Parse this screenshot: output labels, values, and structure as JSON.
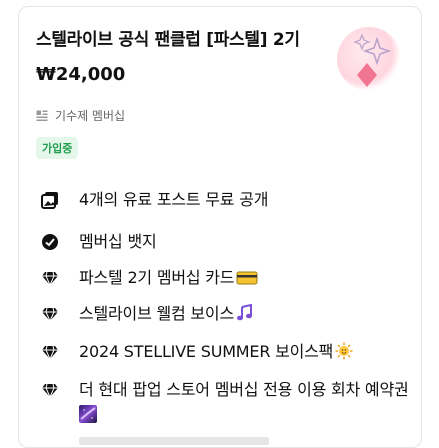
{
  "product": {
    "title": "스텔라이브 공식 팬클럽 [파스텔] 2기",
    "price": "₩24,000",
    "category": "기수제 멤버십",
    "status_badge": "가입중",
    "thumb_icon": "sparkle-logo-icon"
  },
  "benefits": [
    {
      "icon": "image-stack-icon",
      "text": "4개의 유료 포스트 무료 공개"
    },
    {
      "icon": "check-circle-icon",
      "text": "멤버십 뱃지"
    },
    {
      "icon": "diamond-icon",
      "text": "파스텔 2기 멤버십 카드",
      "emoji": "card-emoji"
    },
    {
      "icon": "diamond-icon",
      "text": "스텔라이브 웰컴 보이스",
      "emoji": "music-note-emoji"
    },
    {
      "icon": "diamond-icon",
      "text": "2024 STELLIVE SUMMER 보이스팩",
      "emoji": "sun-emoji"
    },
    {
      "icon": "diamond-icon",
      "text": "더 현대 팝업 스토어 멤버십 전용 이용 회차 예약권",
      "emoji": "galaxy-emoji"
    }
  ],
  "colors": {
    "badge_bg": "#e5f6ea",
    "badge_text": "#20a050",
    "thumb_pink": "#f06a8a"
  }
}
